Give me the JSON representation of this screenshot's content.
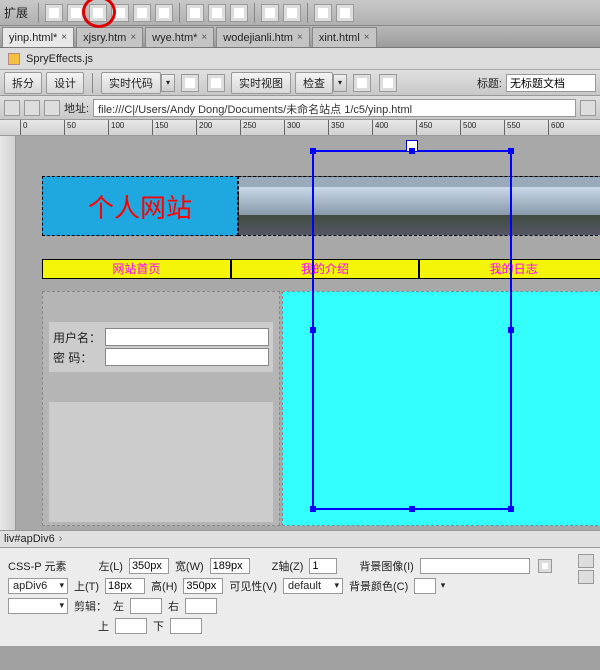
{
  "toolbar": {
    "expand_label": "扩展"
  },
  "tabs": [
    {
      "label": "yinp.html*",
      "active": true
    },
    {
      "label": "xjsry.htm",
      "active": false
    },
    {
      "label": "wye.htm*",
      "active": false
    },
    {
      "label": "wodejianli.htm",
      "active": false
    },
    {
      "label": "xint.html",
      "active": false
    }
  ],
  "subbar": {
    "file": "SpryEffects.js"
  },
  "viewbar": {
    "split": "拆分",
    "design": "设计",
    "live_code": "实时代码",
    "live_view": "实时视图",
    "inspect": "检查",
    "title_label": "标题:",
    "title_value": "无标题文档"
  },
  "addrbar": {
    "label": "地址:",
    "url": "file:///C|/Users/Andy Dong/Documents/未命名站点 1/c5/yinp.html"
  },
  "ruler_ticks": [
    "0",
    "50",
    "100",
    "150",
    "200",
    "250",
    "300",
    "350",
    "400",
    "450",
    "500",
    "550",
    "600"
  ],
  "page": {
    "banner_text": "个人网站",
    "nav": [
      "网站首页",
      "我的介绍",
      "我的日志"
    ],
    "form": {
      "user_label": "用户名：",
      "pwd_label": "密 码："
    }
  },
  "statusbar": {
    "path": "liv#apDiv6"
  },
  "panel": {
    "title": "CSS-P 元素",
    "element": "apDiv6",
    "left_lbl": "左(L)",
    "left_val": "350px",
    "width_lbl": "宽(W)",
    "width_val": "189px",
    "z_lbl": "Z轴(Z)",
    "z_val": "1",
    "bgimg_lbl": "背景图像(I)",
    "top_lbl": "上(T)",
    "top_val": "18px",
    "height_lbl": "高(H)",
    "height_val": "350px",
    "vis_lbl": "可见性(V)",
    "vis_val": "default",
    "bgcolor_lbl": "背景颜色(C)",
    "clip_lbl": "剪辑：",
    "clip_left": "左",
    "clip_right": "右",
    "clip_top": "上",
    "clip_bottom": "下"
  }
}
